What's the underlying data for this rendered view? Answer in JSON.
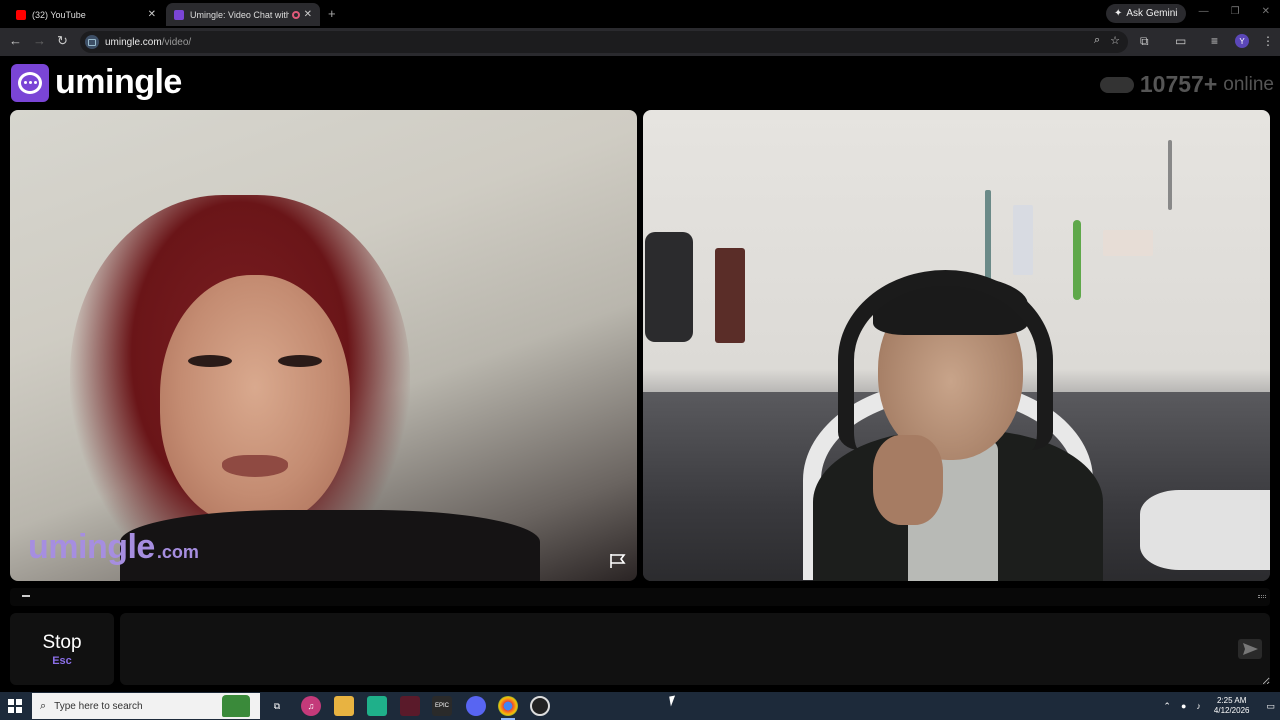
{
  "browser": {
    "tabs": [
      {
        "label": "(32) YouTube",
        "favicon": "youtube-icon",
        "color": "#ff0000"
      },
      {
        "label": "Umingle: Video Chat with S",
        "favicon": "umingle-icon",
        "color": "#7a45d6",
        "recording": true
      }
    ],
    "ask_gemini": "Ask Gemini",
    "url_host": "umingle.com",
    "url_path": "/video/",
    "profile_initial": "Y"
  },
  "site": {
    "logo_text": "umingle",
    "online_count": "10757+",
    "online_label": "online",
    "brand_color": "#7a45d6"
  },
  "stranger_video": {
    "watermark_main": "umingle",
    "watermark_suffix": ".com"
  },
  "controls": {
    "stop_label": "Stop",
    "stop_shortcut": "Esc",
    "chat_placeholder": ""
  },
  "taskbar": {
    "search_placeholder": "Type here to search",
    "time": "2:25 AM",
    "date": "4/12/2026",
    "apps": [
      "task-view",
      "itunes",
      "file-explorer",
      "app-teal",
      "app-maroon",
      "epic-games",
      "discord",
      "chrome",
      "obs"
    ]
  }
}
